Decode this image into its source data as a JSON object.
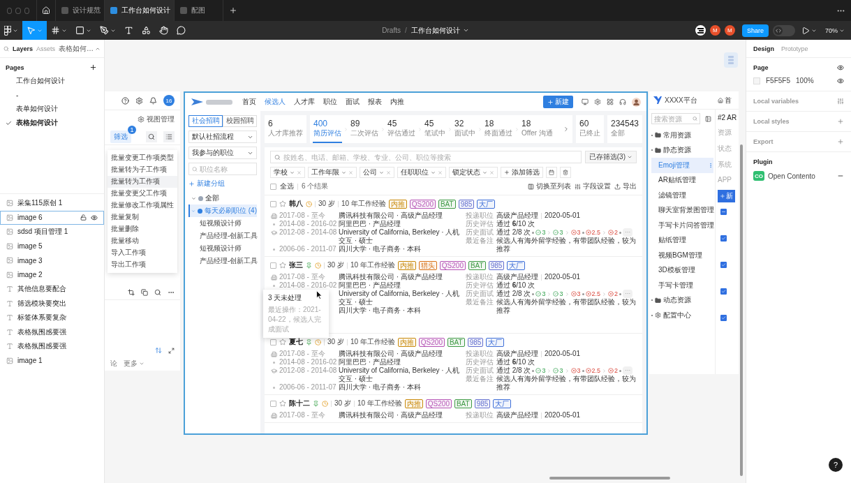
{
  "window": {
    "tabs": [
      {
        "label": "设计规范",
        "selected": false
      },
      {
        "label": "工作台如何设计",
        "selected": true
      },
      {
        "label": "配图",
        "selected": false
      }
    ],
    "tools": [
      {
        "kind": "main-menu",
        "selected": false,
        "caret": true
      },
      {
        "kind": "move",
        "selected": true,
        "caret": true
      },
      {
        "kind": "frame",
        "selected": false,
        "caret": true
      },
      {
        "kind": "shape",
        "selected": false,
        "caret": true
      },
      {
        "kind": "pen",
        "selected": false,
        "caret": true
      },
      {
        "kind": "text",
        "selected": false,
        "caret": false
      },
      {
        "kind": "components",
        "selected": false,
        "caret": false
      },
      {
        "kind": "hand",
        "selected": false,
        "caret": false
      },
      {
        "kind": "comment",
        "selected": false,
        "caret": false
      }
    ],
    "breadcrumb": {
      "folder": "Drafts",
      "separator": "/",
      "file": "工作台如何设计"
    },
    "collaborators": [
      {
        "kind": "logo"
      },
      {
        "kind": "letter",
        "initial": "M"
      },
      {
        "kind": "letter",
        "initial": "M"
      }
    ],
    "share": "Share",
    "dev_mode": {
      "on": false
    },
    "zoom": "70%"
  },
  "layers_panel": {
    "tabs": [
      {
        "label": "Layers",
        "selected": true
      },
      {
        "label": "Assets",
        "selected": false
      }
    ],
    "page_menu": "表格如何…",
    "pages_title": "Pages",
    "pages": [
      {
        "label": "工作台如何设计",
        "selected": false
      },
      {
        "label": "-",
        "selected": false
      },
      {
        "label": "表单如何设计",
        "selected": false
      },
      {
        "label": "表格如何设计",
        "selected": true
      }
    ],
    "layers": [
      {
        "name": "采集115原创 1",
        "kind": "image",
        "selected": false
      },
      {
        "name": "image 6",
        "kind": "image",
        "selected": true
      },
      {
        "name": "sdsd 项目管理 1",
        "kind": "image",
        "selected": false
      },
      {
        "name": "image 5",
        "kind": "image",
        "selected": false
      },
      {
        "name": "image 3",
        "kind": "image",
        "selected": false
      },
      {
        "name": "image 2",
        "kind": "image",
        "selected": false
      },
      {
        "name": "其他信息要配合",
        "kind": "text",
        "selected": false
      },
      {
        "name": "筛选模块要突出",
        "kind": "text",
        "selected": false
      },
      {
        "name": "标签体系要复杂",
        "kind": "text",
        "selected": false
      },
      {
        "name": "表格氛围感要强",
        "kind": "text",
        "selected": false
      },
      {
        "name": "表格氛围感要强",
        "kind": "text",
        "selected": false
      },
      {
        "name": "image 1",
        "kind": "image",
        "selected": false
      }
    ]
  },
  "canvas": {
    "worklist_frame": {
      "badge": "16",
      "view_manage": "视图管理",
      "filter": {
        "label": "筛选",
        "count": "1"
      },
      "menu": [
        {
          "label": "批量变更工作项类型",
          "highlighted": false
        },
        {
          "label": "批量转为子工作项",
          "highlighted": false
        },
        {
          "label": "批量转为工作项",
          "highlighted": true
        },
        {
          "label": "批量变更父工作项",
          "highlighted": false
        },
        {
          "label": "批量修改工作项属性",
          "highlighted": false
        },
        {
          "label": "批量复制",
          "highlighted": false
        },
        {
          "label": "批量删除",
          "highlighted": false
        },
        {
          "label": "批量移动",
          "highlighted": false
        },
        {
          "label": "导入工作项",
          "highlighted": false
        },
        {
          "label": "导出工作项",
          "highlighted": false
        }
      ],
      "footer": {
        "comment": "论",
        "more": "更多"
      }
    },
    "recruit_frame": {
      "nav": [
        {
          "label": "首页",
          "selected": false
        },
        {
          "label": "候选人",
          "selected": true
        },
        {
          "label": "人才库",
          "selected": false
        },
        {
          "label": "职位",
          "selected": false
        },
        {
          "label": "面试",
          "selected": false
        },
        {
          "label": "报表",
          "selected": false
        },
        {
          "label": "内推",
          "selected": false
        }
      ],
      "new_button": "新建",
      "channels": [
        {
          "label": "社会招聘",
          "selected": true
        },
        {
          "label": "校园招聘",
          "selected": false
        }
      ],
      "selects": [
        "默认社招流程",
        "我参与的职位"
      ],
      "position_search": {
        "placeholder": "职位名称"
      },
      "new_group": "新建分组",
      "groups": [
        {
          "label": "全部",
          "selected": false
        },
        {
          "label": "每天必刷职位",
          "count": "(4)",
          "selected": true,
          "children": [
            {
              "label": "短视频设计师",
              "selected": false
            },
            {
              "label": "产品经理-创新工具",
              "selected": false
            },
            {
              "label": "短视频设计师",
              "selected": false
            },
            {
              "label": "产品经理-创新工具",
              "selected": false
            }
          ]
        }
      ],
      "stat_cards": [
        {
          "next": false,
          "stats": [
            {
              "value": "6",
              "label": "人才库推荐",
              "selected": false
            }
          ]
        },
        {
          "next": true,
          "stats": [
            {
              "value": "400",
              "label": "简历评估",
              "selected": true
            },
            {
              "value": "89",
              "label": "二次评估",
              "selected": false
            },
            {
              "value": "45",
              "label": "评估通过",
              "selected": false
            },
            {
              "value": "45",
              "label": "笔试中",
              "selected": false
            },
            {
              "value": "32",
              "label": "面试中",
              "selected": false
            },
            {
              "value": "18",
              "label": "终面通过",
              "selected": false
            },
            {
              "value": "18",
              "label": "Offer 沟通",
              "selected": false
            }
          ]
        },
        {
          "next": false,
          "stats": [
            {
              "value": "60",
              "label": "已终止",
              "selected": false
            }
          ]
        },
        {
          "next": false,
          "stats": [
            {
              "value": "234543",
              "label": "全部",
              "selected": false
            }
          ]
        }
      ],
      "search": {
        "placeholder": "按姓名、电话、邮箱、学校、专业、公司、职位等搜索"
      },
      "saved_filters": "已存筛选(3)",
      "filters": [
        "学校",
        "工作年限",
        "公司",
        "任职职位",
        "锁定状态"
      ],
      "add_filter": "添加筛选",
      "select_all": {
        "label": "全选",
        "checked": false
      },
      "result_count": "6 个结果",
      "actions": [
        {
          "label": "切换至列表",
          "kind": "list"
        },
        {
          "label": "字段设置",
          "kind": "fields"
        },
        {
          "label": "导出",
          "kind": "export"
        }
      ],
      "candidates": [
        {
          "name": "韩八",
          "checked": false,
          "starred": false,
          "pinned": false,
          "age": "30 岁",
          "experience": "10 年工作经验",
          "tags": [
            {
              "text": "内推",
              "color": "#c98a0b"
            },
            {
              "text": "QS200",
              "color": "#b656b6"
            },
            {
              "text": "BAT",
              "color": "#3f9a45"
            },
            {
              "text": "985",
              "color": "#6470cf"
            },
            {
              "text": "大厂",
              "color": "#3f6fd8"
            }
          ],
          "history": [
            {
              "kind": "employer",
              "period": "2017-08 - 至今",
              "text": "腾讯科技有限公司 · 高级产品经理"
            },
            {
              "kind": "continued",
              "period": "2014-08 - 2016-02",
              "text": "阿里巴巴 · 产品经理"
            },
            {
              "kind": "school",
              "period": "2012-08 - 2014-08",
              "text": "University of California, Berkeley · 人机交互 · 硕士"
            },
            {
              "kind": "continued",
              "period": "2006-06 - 2011-07",
              "text": "四川大学 · 电子商务 · 本科"
            }
          ],
          "fields": [
            {
              "kind": "position",
              "label": "投递职位",
              "value": "高级产品经理",
              "date": "2020-05-01"
            },
            {
              "kind": "evaluation",
              "label": "历史评估",
              "value": "通过 **6**/10 次"
            },
            {
              "kind": "interviews",
              "label": "历史面试",
              "value": "通过 2/8 次",
              "rounds": [
                {
                  "steps": [
                    {
                      "score": "3",
                      "passed": true
                    },
                    {
                      "score": "3",
                      "passed": true
                    },
                    {
                      "score": "3",
                      "passed": false
                    }
                  ]
                },
                {
                  "steps": [
                    {
                      "score": "2.5",
                      "passed": false
                    },
                    {
                      "score": "2",
                      "passed": false
                    }
                  ]
                }
              ],
              "more": "···"
            },
            {
              "kind": "note",
              "label": "最近备注",
              "value": "候选人有海外留学经验，有带团队经验，较为推荐"
            }
          ]
        },
        {
          "name": "张三",
          "checked": false,
          "starred": false,
          "pinned": true,
          "age": "30 岁",
          "experience": "10 年工作经验",
          "tags": [
            {
              "text": "内推",
              "color": "#c98a0b"
            },
            {
              "text": "猎头",
              "color": "#d9731a"
            },
            {
              "text": "QS200",
              "color": "#b656b6"
            },
            {
              "text": "BAT",
              "color": "#3f9a45"
            },
            {
              "text": "985",
              "color": "#6470cf"
            },
            {
              "text": "大厂",
              "color": "#3f6fd8"
            }
          ],
          "history": [
            {
              "kind": "employer",
              "period": "2017-08 - 至今",
              "text": "腾讯科技有限公司 · 高级产品经理"
            },
            {
              "kind": "continued",
              "period": "2014-08 - 2016-02",
              "text": "阿里巴巴 · 产品经理"
            },
            {
              "text": "University of California, Berkeley · 人机交互 · 硕士"
            },
            {
              "text": "四川大学 · 电子商务 · 本科"
            }
          ],
          "fields": [
            {
              "kind": "position",
              "label": "投递职位",
              "value": "高级产品经理",
              "date": "2020-05-01"
            },
            {
              "kind": "evaluation",
              "label": "历史评估",
              "value": "通过 **6**/10 次"
            },
            {
              "kind": "interviews",
              "label": "历史面试",
              "value": "通过 2/8 次",
              "rounds": [
                {
                  "steps": [
                    {
                      "score": "3",
                      "passed": true
                    },
                    {
                      "score": "3",
                      "passed": true
                    },
                    {
                      "score": "3",
                      "passed": false
                    }
                  ]
                },
                {
                  "steps": [
                    {
                      "score": "2.5",
                      "passed": false
                    },
                    {
                      "score": "2",
                      "passed": false
                    }
                  ]
                }
              ],
              "more": "···"
            },
            {
              "kind": "note",
              "label": "最近备注",
              "value": "候选人有海外留学经验，有带团队经验，较为推荐"
            }
          ],
          "tooltip": {
            "title": "3 天未处理",
            "detail": "最近操作：2021-04-22，候选人完成面试"
          }
        },
        {
          "name": "夏七",
          "checked": false,
          "starred": false,
          "pinned": true,
          "age": "30 岁",
          "experience": "10 年工作经验",
          "tags": [
            {
              "text": "内推",
              "color": "#c98a0b"
            },
            {
              "text": "QS200",
              "color": "#b656b6"
            },
            {
              "text": "BAT",
              "color": "#3f9a45"
            },
            {
              "text": "985",
              "color": "#6470cf"
            },
            {
              "text": "大厂",
              "color": "#3f6fd8"
            }
          ],
          "history": [
            {
              "kind": "employer",
              "period": "2017-08 - 至今",
              "text": "腾讯科技有限公司 · 高级产品经理"
            },
            {
              "kind": "continued",
              "period": "2014-08 - 2016-02",
              "text": "阿里巴巴 · 产品经理"
            },
            {
              "kind": "school",
              "period": "2012-08 - 2014-08",
              "text": "University of California, Berkeley · 人机交互 · 硕士"
            },
            {
              "kind": "continued",
              "period": "2006-06 - 2011-07",
              "text": "四川大学 · 电子商务 · 本科"
            }
          ],
          "fields": [
            {
              "kind": "position",
              "label": "投递职位",
              "value": "高级产品经理",
              "date": "2020-05-01"
            },
            {
              "kind": "evaluation",
              "label": "历史评估",
              "value": "通过 **6**/10 次"
            },
            {
              "kind": "interviews",
              "label": "历史面试",
              "value": "通过 2/8 次",
              "rounds": [
                {
                  "steps": [
                    {
                      "score": "3",
                      "passed": true
                    },
                    {
                      "score": "3",
                      "passed": true
                    },
                    {
                      "score": "3",
                      "passed": false
                    }
                  ]
                },
                {
                  "steps": [
                    {
                      "score": "2.5",
                      "passed": false
                    },
                    {
                      "score": "2",
                      "passed": false
                    }
                  ]
                }
              ],
              "more": "···"
            },
            {
              "kind": "note",
              "label": "最近备注",
              "value": "候选人有海外留学经验，有带团队经验，较为推荐"
            }
          ]
        },
        {
          "name": "陈十二",
          "checked": false,
          "starred": false,
          "pinned": true,
          "age": "30 岁",
          "experience": "10 年工作经验",
          "tags": [
            {
              "text": "内推",
              "color": "#c98a0b"
            },
            {
              "text": "QS200",
              "color": "#b656b6"
            },
            {
              "text": "BAT",
              "color": "#3f9a45"
            },
            {
              "text": "985",
              "color": "#6470cf"
            },
            {
              "text": "大厂",
              "color": "#3f6fd8"
            }
          ],
          "history": [
            {
              "kind": "employer",
              "period": "2017-08 - 至今",
              "text": "腾讯科技有限公司 · 高级产品经理"
            }
          ],
          "fields": [
            {
              "kind": "position",
              "label": "投递职位",
              "value": "高级产品经理",
              "date": "2020-05-01"
            }
          ]
        }
      ]
    },
    "resource_frame": {
      "brand": "XXXX平台",
      "home": "首",
      "search": {
        "placeholder": "搜索资源"
      },
      "tree": [
        {
          "label": "常用资源",
          "kind": "folder"
        },
        {
          "label": "静态资源",
          "kind": "folder",
          "children": [
            {
              "label": "Emoji管理",
              "selected": true
            },
            {
              "label": "AR贴纸管理",
              "selected": false
            },
            {
              "label": "滤镜管理",
              "selected": false
            },
            {
              "label": "聊天室背景图管理",
              "selected": false
            },
            {
              "label": "手写卡片问答管理",
              "selected": false
            },
            {
              "label": "贴纸管理",
              "selected": false
            },
            {
              "label": "视频BGM管理",
              "selected": false
            },
            {
              "label": "3D模板管理",
              "selected": false
            },
            {
              "label": "手写卡管理",
              "selected": false
            }
          ]
        },
        {
          "label": "动态资源",
          "kind": "folder"
        },
        {
          "label": "配置中心",
          "kind": "settings"
        }
      ],
      "detail": {
        "title": "#2 AR",
        "fields": [
          "资源",
          "状态",
          "系统",
          "APP"
        ],
        "add_button": "新",
        "header_check": {
          "indeterminate": true
        },
        "rows": [
          {
            "checked": true
          },
          {
            "checked": true
          },
          {
            "checked": true
          },
          {
            "checked": true
          }
        ]
      }
    }
  },
  "design_panel": {
    "tabs": [
      {
        "label": "Design",
        "selected": true
      },
      {
        "label": "Prototype",
        "selected": false
      }
    ],
    "page": {
      "title": "Page",
      "color": "#f5f5f5",
      "hex": "F5F5F5",
      "opacity": "100%",
      "visible": true
    },
    "sections": [
      {
        "title": "Local variables",
        "kind": "variables"
      },
      {
        "title": "Local styles",
        "kind": "add"
      },
      {
        "title": "Export",
        "kind": "add"
      }
    ],
    "plugin": {
      "title": "Plugin",
      "items": [
        {
          "badge": "CO",
          "name": "Open Contento"
        }
      ]
    }
  },
  "help": "?"
}
